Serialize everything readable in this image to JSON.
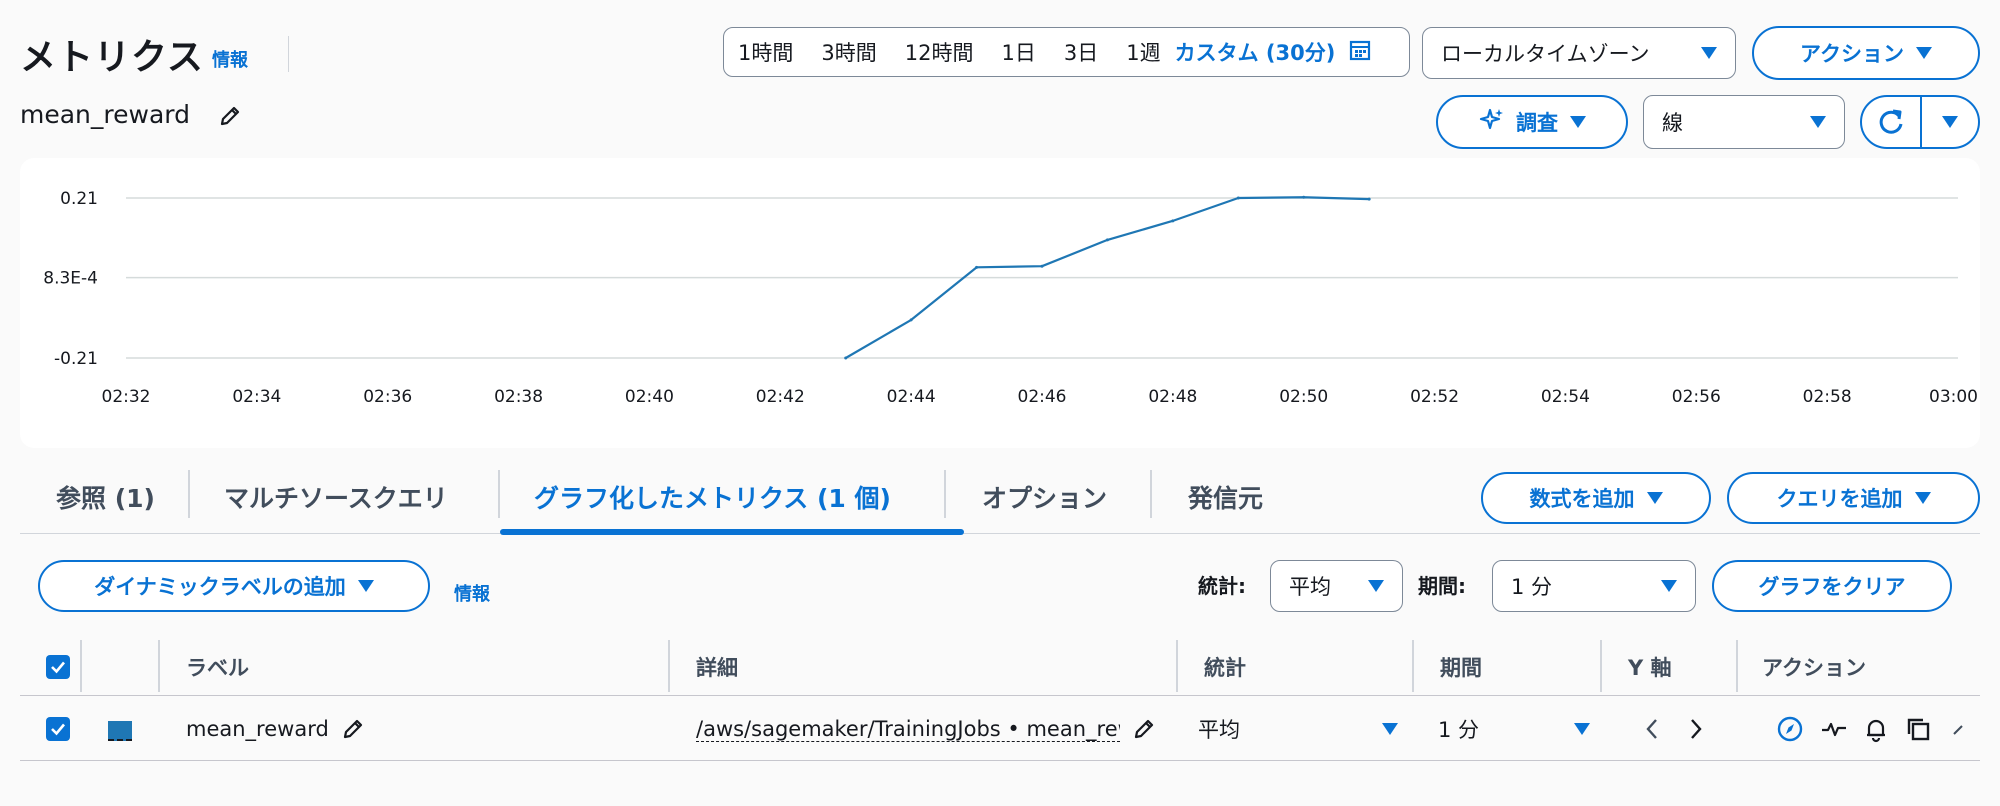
{
  "header": {
    "title": "メトリクス",
    "info_label": "情報",
    "metric_name": "mean_reward"
  },
  "time_range": {
    "options": [
      "1時間",
      "3時間",
      "12時間",
      "1日",
      "3日",
      "1週"
    ],
    "custom_label": "カスタム (30分)"
  },
  "timezone": {
    "value": "ローカルタイムゾーン"
  },
  "actions_button": "アクション",
  "investigate_button": "調査",
  "chart_type": {
    "value": "線"
  },
  "chart_data": {
    "type": "line",
    "yticks": [
      "0.21",
      "8.3E-4",
      "-0.21"
    ],
    "ytick_values": [
      0.21,
      0.00083,
      -0.21
    ],
    "ylim": [
      -0.21,
      0.21
    ],
    "xticks": [
      "02:32",
      "02:34",
      "02:36",
      "02:38",
      "02:40",
      "02:42",
      "02:44",
      "02:46",
      "02:48",
      "02:50",
      "02:52",
      "02:54",
      "02:56",
      "02:58",
      "03:00"
    ],
    "x_minutes": [
      43,
      44,
      45,
      46,
      47,
      48,
      49,
      50,
      51
    ],
    "values": [
      -0.21,
      -0.11,
      0.028,
      0.031,
      0.1,
      0.15,
      0.21,
      0.212,
      0.207
    ],
    "xlim_minutes": [
      32,
      60
    ],
    "color": "#1f77b4",
    "grid": true
  },
  "tabs": [
    {
      "label": "参照 (1)"
    },
    {
      "label": "マルチソースクエリ"
    },
    {
      "label": "グラフ化したメトリクス (1 個)"
    },
    {
      "label": "オプション"
    },
    {
      "label": "発信元"
    }
  ],
  "add_math_button": "数式を追加",
  "add_query_button": "クエリを追加",
  "dynamic_label_button": "ダイナミックラベルの追加",
  "info_label2": "情報",
  "stat": {
    "label": "統計:",
    "value": "平均"
  },
  "period": {
    "label": "期間:",
    "value": "1 分"
  },
  "clear_graph_button": "グラフをクリア",
  "table": {
    "headers": [
      "ラベル",
      "詳細",
      "統計",
      "期間",
      "Y 軸",
      "アクション"
    ],
    "rows": [
      {
        "color": "#1f77b4",
        "label": "mean_reward",
        "details": "/aws/sagemaker/TrainingJobs • mean_reward",
        "stat": "平均",
        "period": "1 分"
      }
    ]
  }
}
